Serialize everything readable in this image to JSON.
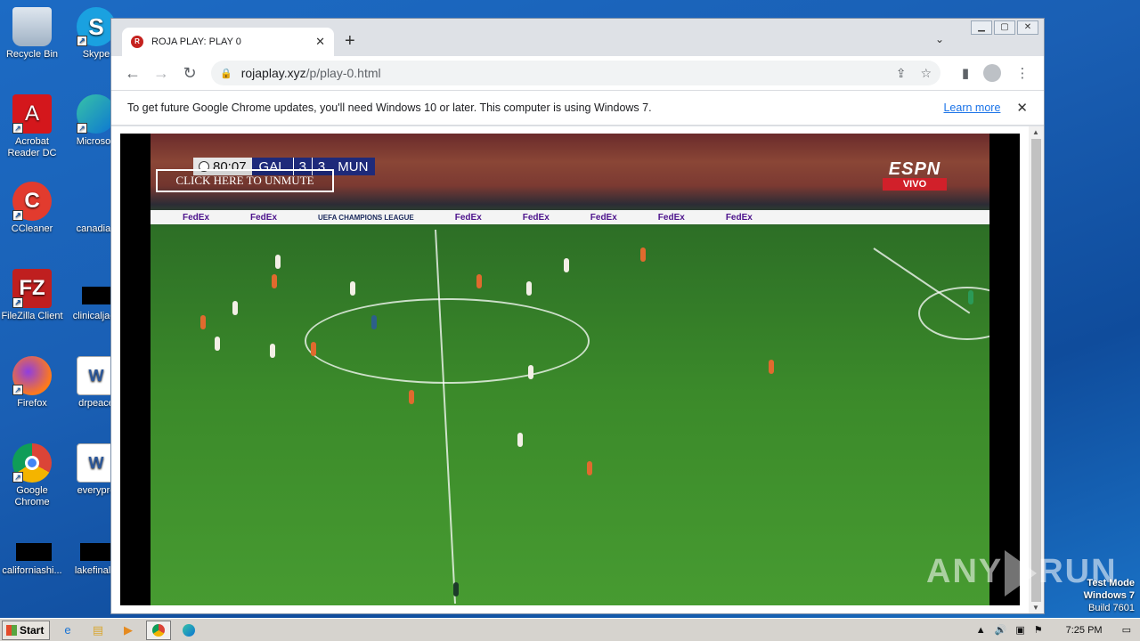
{
  "desktop": {
    "icons": [
      {
        "label": "Recycle Bin",
        "icon": "recycle-bin-icon"
      },
      {
        "label": "Skype",
        "icon": "skype-icon"
      },
      {
        "label": "Acrobat Reader DC",
        "icon": "acrobat-icon"
      },
      {
        "label": "Microsoft",
        "icon": "edge-icon"
      },
      {
        "label": "CCleaner",
        "icon": "ccleaner-icon"
      },
      {
        "label": "canadian",
        "icon": "document-icon"
      },
      {
        "label": "FileZilla Client",
        "icon": "filezilla-icon"
      },
      {
        "label": "clinicaljack",
        "icon": "document-icon"
      },
      {
        "label": "Firefox",
        "icon": "firefox-icon"
      },
      {
        "label": "drpeace",
        "icon": "word-icon"
      },
      {
        "label": "Google Chrome",
        "icon": "chrome-icon"
      },
      {
        "label": "everypre",
        "icon": "word-icon"
      },
      {
        "label": "californiashi...",
        "icon": "document-icon"
      },
      {
        "label": "lakefinally",
        "icon": "document-icon"
      }
    ],
    "watermark": {
      "left": "ANY",
      "right": "RUN"
    },
    "test_mode": {
      "line1": "Test Mode",
      "line2": "Windows 7",
      "line3": "Build 7601"
    }
  },
  "browser": {
    "tab": {
      "title": "ROJA PLAY: PLAY 0",
      "favicon": "roja-favicon"
    },
    "url": {
      "host": "rojaplay.xyz",
      "path": "/p/play-0.html"
    },
    "infobar": {
      "message": "To get future Google Chrome updates, you'll need Windows 10 or later. This computer is using Windows 7.",
      "link": "Learn more"
    },
    "window_controls": [
      "minimize",
      "maximize",
      "close"
    ]
  },
  "player": {
    "scorebug": {
      "clock": "80:07",
      "home": "GAL",
      "home_score": "3",
      "away_score": "3",
      "away": "MUN"
    },
    "unmute_label": "CLICK HERE TO UNMUTE",
    "broadcaster": "ESPN",
    "live_badge": "VIVO",
    "ad_text": "FedEx",
    "competition": "UEFA CHAMPIONS LEAGUE"
  },
  "taskbar": {
    "start_label": "Start",
    "clock": "7:25 PM",
    "apps": [
      "ie-icon",
      "explorer-icon",
      "media-player-icon",
      "chrome-icon",
      "edge-icon"
    ]
  }
}
